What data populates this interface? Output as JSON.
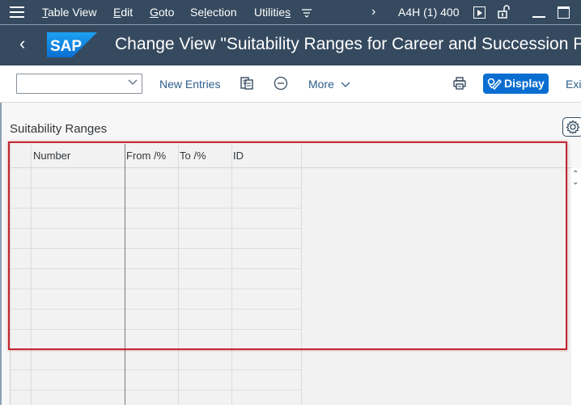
{
  "menubar": {
    "items": [
      {
        "label": "Table View",
        "mnemonic_index": 0
      },
      {
        "label": "Edit",
        "mnemonic_index": 0
      },
      {
        "label": "Goto",
        "mnemonic_index": 0
      },
      {
        "label": "Selection",
        "mnemonic_index": 2
      },
      {
        "label": "Utilities",
        "mnemonic_index": 8
      }
    ],
    "system": "A4H (1) 400",
    "icons": [
      "hamburger-icon",
      "more-menu-icon",
      "chevron-right-icon",
      "play-icon",
      "lock-icon",
      "minimize-icon",
      "maximize-icon"
    ]
  },
  "titlebar": {
    "back_icon": "chevron-left-icon",
    "logo": "SAP",
    "title": "Change View \"Suitability Ranges for Career and Succession Planning\": Overview"
  },
  "toolbar": {
    "select_value": "",
    "new_entries": "New Entries",
    "copy_icon": "copy-icon",
    "delete_icon": "minus-circle-icon",
    "more": "More",
    "print_icon": "print-icon",
    "display": "Display",
    "exit": "Exit"
  },
  "content": {
    "section_title": "Suitability Ranges",
    "table": {
      "columns": [
        "",
        "Number",
        "From /%",
        "To /%",
        "ID"
      ],
      "rows": [
        [
          "",
          "",
          "",
          "",
          ""
        ],
        [
          "",
          "",
          "",
          "",
          ""
        ],
        [
          "",
          "",
          "",
          "",
          ""
        ],
        [
          "",
          "",
          "",
          "",
          ""
        ],
        [
          "",
          "",
          "",
          "",
          ""
        ],
        [
          "",
          "",
          "",
          "",
          ""
        ],
        [
          "",
          "",
          "",
          "",
          ""
        ],
        [
          "",
          "",
          "",
          "",
          ""
        ],
        [
          "",
          "",
          "",
          "",
          ""
        ],
        [
          "",
          "",
          "",
          "",
          ""
        ],
        [
          "",
          "",
          "",
          "",
          ""
        ],
        [
          "",
          "",
          "",
          "",
          ""
        ]
      ]
    }
  },
  "colors": {
    "shell": "#354a5f",
    "accent": "#0a6ed1",
    "highlight": "#c0282f",
    "link": "#2d5e8c"
  }
}
